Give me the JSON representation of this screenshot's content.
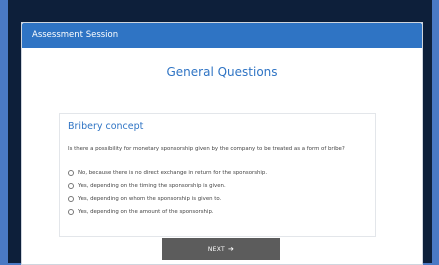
{
  "header": {
    "title": "Assessment Session"
  },
  "page": {
    "title": "General Questions"
  },
  "card": {
    "title": "Bribery concept",
    "question": "Is there a possibility for monetary sponsorship given by the company to be treated as a form of bribe?",
    "options": [
      "No, because there is no direct exchange in return for the sponsorship.",
      "Yes, depending on the timing the sponsorship is given.",
      "Yes, depending on whom the sponsorship is given to.",
      "Yes, depending on the amount of the sponsorship."
    ]
  },
  "footer": {
    "next_label": "NEXT",
    "next_icon": "arrow-right-icon"
  }
}
